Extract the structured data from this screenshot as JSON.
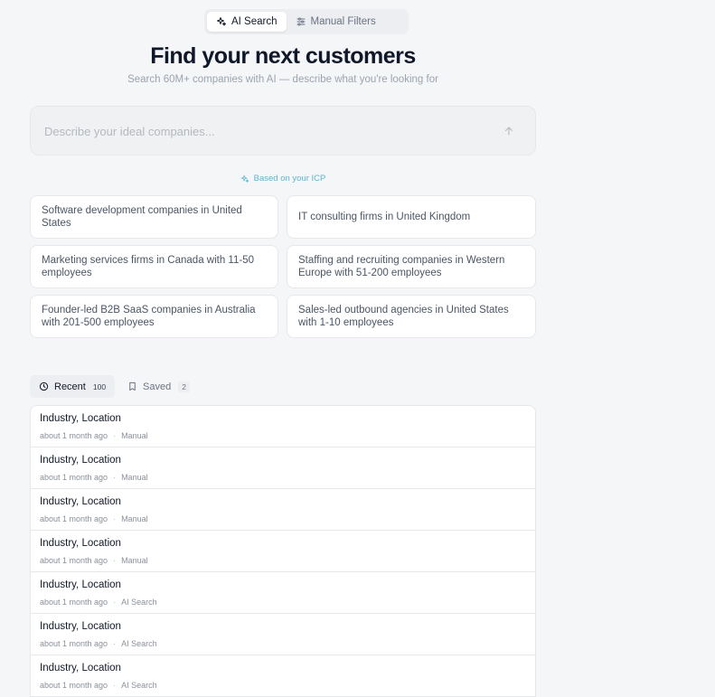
{
  "mode_toggle": {
    "ai_search_label": "AI Search",
    "manual_filters_label": "Manual Filters"
  },
  "hero": {
    "title": "Find your next customers",
    "subtitle": "Search 60M+ companies with AI — describe what you're looking for"
  },
  "search": {
    "placeholder": "Describe your ideal companies...",
    "value": ""
  },
  "icp_label": "Based on your ICP",
  "suggestions": [
    "Software development companies in United States",
    "IT consulting firms in United Kingdom",
    "Marketing services firms in Canada with 11-50 employees",
    "Staffing and recruiting companies in Western Europe with 51-200 employees",
    "Founder-led B2B SaaS companies in Australia with 201-500 employees",
    "Sales-led outbound agencies in United States with 1-10 employees"
  ],
  "tabs": {
    "recent_label": "Recent",
    "recent_count": "100",
    "saved_label": "Saved",
    "saved_count": "2"
  },
  "recent": [
    {
      "title": "Industry, Location",
      "time": "about 1 month ago",
      "source": "Manual"
    },
    {
      "title": "Industry, Location",
      "time": "about 1 month ago",
      "source": "Manual"
    },
    {
      "title": "Industry, Location",
      "time": "about 1 month ago",
      "source": "Manual"
    },
    {
      "title": "Industry, Location",
      "time": "about 1 month ago",
      "source": "Manual"
    },
    {
      "title": "Industry, Location",
      "time": "about 1 month ago",
      "source": "AI Search"
    },
    {
      "title": "Industry, Location",
      "time": "about 1 month ago",
      "source": "AI Search"
    },
    {
      "title": "Industry, Location",
      "time": "about 1 month ago",
      "source": "AI Search"
    }
  ],
  "meta_separator": "·",
  "colors": {
    "accent": "#5bb6cf",
    "background": "#f5f6f8",
    "title": "#0f172a"
  }
}
